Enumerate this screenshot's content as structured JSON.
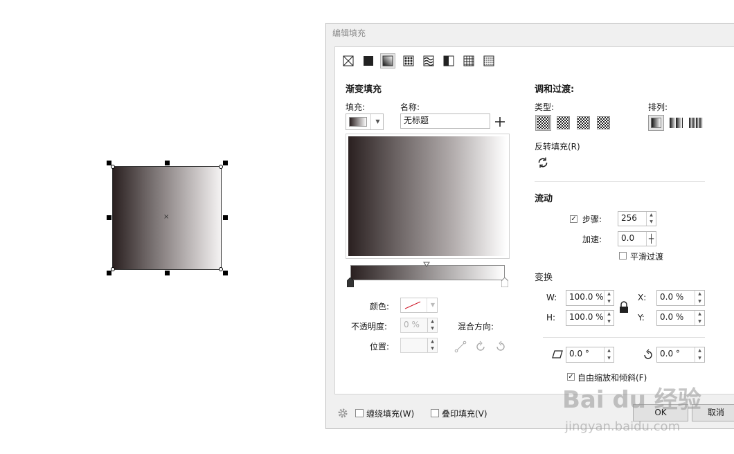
{
  "dialog": {
    "title": "编辑填充",
    "section_title": "渐变填充",
    "fill_label": "填充:",
    "name_label": "名称:",
    "name_value": "无标题",
    "color_label": "颜色:",
    "opacity_label": "不透明度:",
    "opacity_value": "0 %",
    "position_label": "位置:",
    "blend_dir_label": "混合方向:",
    "blend_title": "调和过渡:",
    "type_label": "类型:",
    "arrange_label": "排列:",
    "reverse_label": "反转填充(R)",
    "flow_title": "流动",
    "steps_label": "步骤:",
    "steps_value": "256",
    "accel_label": "加速:",
    "accel_value": "0.0",
    "smooth_label": "平滑过渡",
    "transform_title": "变换",
    "w_label": "W:",
    "w_value": "100.0 %",
    "h_label": "H:",
    "h_value": "100.0 %",
    "x_label": "X:",
    "x_value": "0.0 %",
    "y_label": "Y:",
    "y_value": "0.0 %",
    "skew_value": "0.0 °",
    "rotate_value": "0.0 °",
    "free_scale_label": "自由缩放和倾斜(F)",
    "wrap_fill_label": "缠绕填充(W)",
    "overprint_label": "叠印填充(V)",
    "ok_label": "OK",
    "cancel_label": "取消",
    "steps_checked": true,
    "free_scale_checked": true,
    "gradient_start_color": "#2a2020",
    "gradient_end_color": "#ffffff"
  },
  "toolbar_icons": [
    "no-fill-icon",
    "uniform-fill-icon",
    "gradient-fill-icon",
    "vector-pattern-icon",
    "bitmap-pattern-icon",
    "two-color-pattern-icon",
    "texture-fill-icon",
    "postscript-fill-icon"
  ],
  "watermark": {
    "brand": "Bai du 经验",
    "url": "jingyan.baidu.com"
  }
}
